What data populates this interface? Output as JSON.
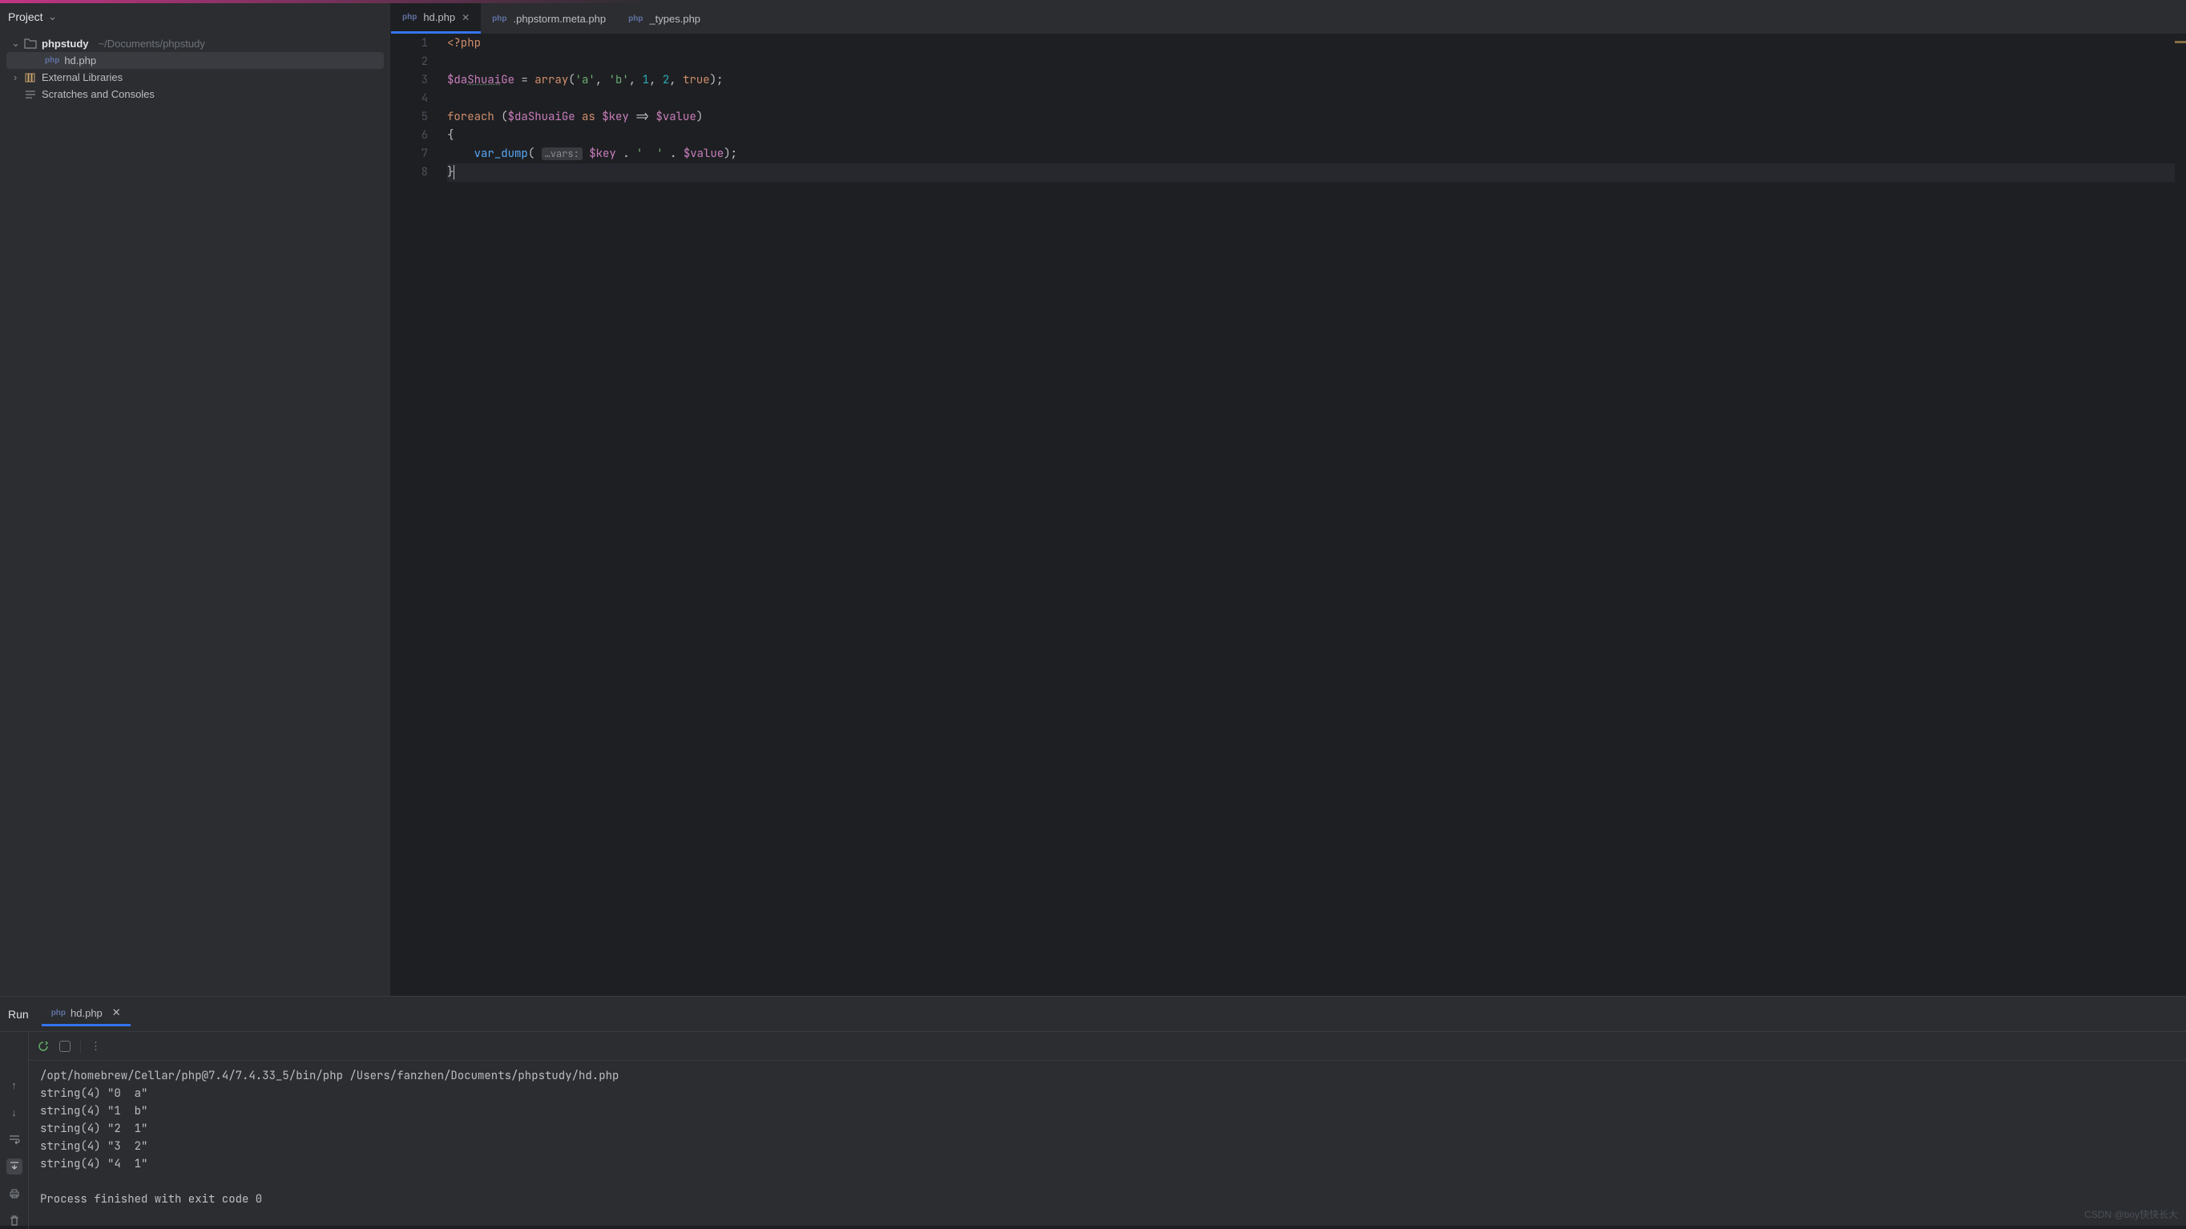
{
  "project": {
    "title": "Project",
    "root": {
      "name": "phpstudy",
      "path": "~/Documents/phpstudy"
    },
    "files": [
      {
        "icon": "php",
        "name": "hd.php",
        "selected": true
      }
    ],
    "external_libraries": "External Libraries",
    "scratches": "Scratches and Consoles"
  },
  "tabs": [
    {
      "icon": "php",
      "label": "hd.php",
      "active": true,
      "closeable": true
    },
    {
      "icon": "php",
      "label": ".phpstorm.meta.php",
      "active": false,
      "closeable": false
    },
    {
      "icon": "php",
      "label": "_types.php",
      "active": false,
      "closeable": false
    }
  ],
  "code": {
    "line_count": 8,
    "lines": {
      "l1_open": "<?php",
      "l3_var": "$daShuaiGe",
      "l3_eq": " = ",
      "l3_arr": "array",
      "l3_rest1": "(",
      "l3_sa": "'a'",
      "l3_c1": ", ",
      "l3_sb": "'b'",
      "l3_c2": ", ",
      "l3_n1": "1",
      "l3_c3": ", ",
      "l3_n2": "2",
      "l3_c4": ", ",
      "l3_true": "true",
      "l3_end": ");",
      "l5_foreach": "foreach",
      "l5_open": " (",
      "l5_var": "$daShuaiGe",
      "l5_as": " as ",
      "l5_key": "$key",
      "l5_arrow": " => ",
      "l5_val": "$value",
      "l5_close": ")",
      "l6": "{",
      "l7_indent": "    ",
      "l7_fn": "var_dump",
      "l7_open": "(",
      "l7_hint": "…vars:",
      "l7_key": " $key",
      "l7_dot1": " . ",
      "l7_str": "'  '",
      "l7_dot2": " . ",
      "l7_val": "$value",
      "l7_end": ");",
      "l8": "}"
    }
  },
  "run": {
    "label": "Run",
    "tab": {
      "icon": "php",
      "name": "hd.php"
    },
    "output": "/opt/homebrew/Cellar/php@7.4/7.4.33_5/bin/php /Users/fanzhen/Documents/phpstudy/hd.php\nstring(4) \"0  a\"\nstring(4) \"1  b\"\nstring(4) \"2  1\"\nstring(4) \"3  2\"\nstring(4) \"4  1\"\n\nProcess finished with exit code 0"
  },
  "watermark": "CSDN @boy快快长大"
}
